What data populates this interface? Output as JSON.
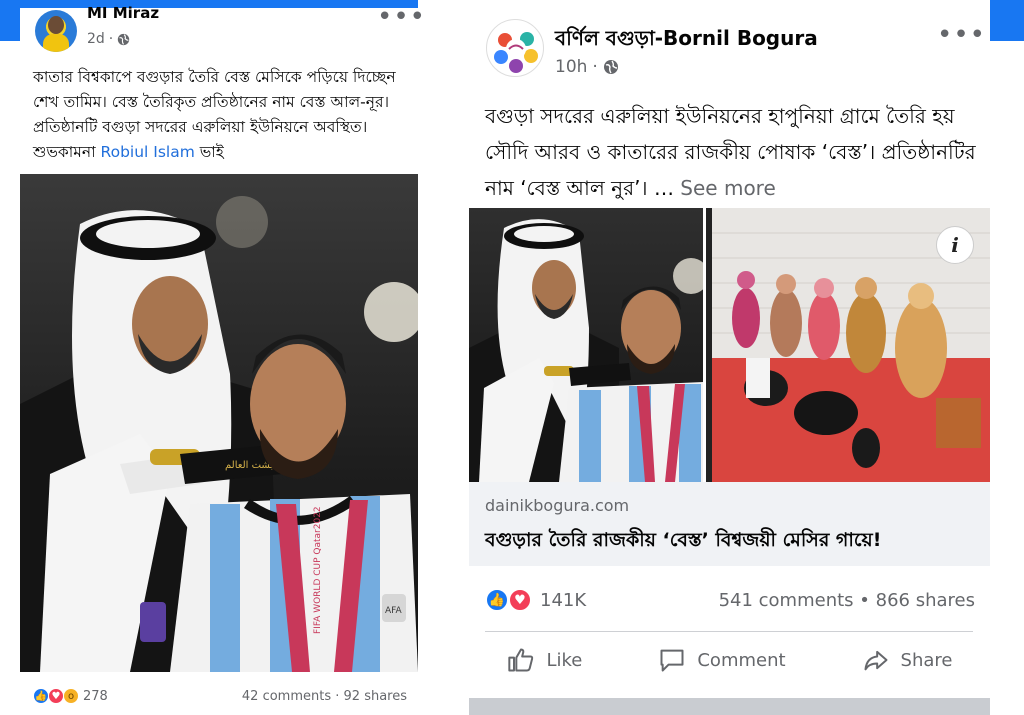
{
  "left_post": {
    "author": "MI Miraz",
    "time": "2d",
    "text_main": "কাতার বিশ্বকাপে বগুড়ার তৈরি বেস্ত মেসিকে পড়িয়ে দিচ্ছেন শেখ তামিম। বেস্ত তৈরিকৃত প্রতিষ্ঠানের নাম বেস্ত আল-নূর। প্রতিষ্ঠানটি বগুড়া সদরের এরুলিয়া ইউনিয়নে অবস্থিত। শুভকামনা ",
    "mention": "Robiul Islam",
    "text_after": " ভাই",
    "reaction_count": "278",
    "comments": "42 comments",
    "shares": "92 shares",
    "photo_labels": {
      "sash": "بشت العالم",
      "medal_ribbon": "FIFA WORLD CUP Qatar2022",
      "badge": "AFA"
    }
  },
  "right_post": {
    "page_name": "বর্ণিল বগুড়া-Bornil Bogura",
    "time": "10h",
    "text_main": "বগুড়া সদরের এরুলিয়া ইউনিয়নের হাপুনিয়া গ্রামে তৈরি হয় সৌদি আরব ও কাতারের রাজকীয় পোষাক ‘বেস্ত’। প্রতিষ্ঠানটির নাম ‘বেস্ত আল নুর’। … ",
    "see_more": "See more",
    "info_icon_label": "i",
    "link_domain": "dainikbogura.com",
    "link_title": "বগুড়ার তৈরি রাজকীয় ‘বেস্ত’ বিশ্বজয়ী মেসির গায়ে!",
    "reaction_count": "141K",
    "comments": "541 comments",
    "separator": "•",
    "shares": "866 shares",
    "actions": {
      "like": "Like",
      "comment": "Comment",
      "share": "Share"
    }
  },
  "colors": {
    "facebook_blue": "#1877f2",
    "love_red": "#f33e58",
    "wow_yellow": "#f7b125",
    "secondary_text": "#65676b"
  }
}
